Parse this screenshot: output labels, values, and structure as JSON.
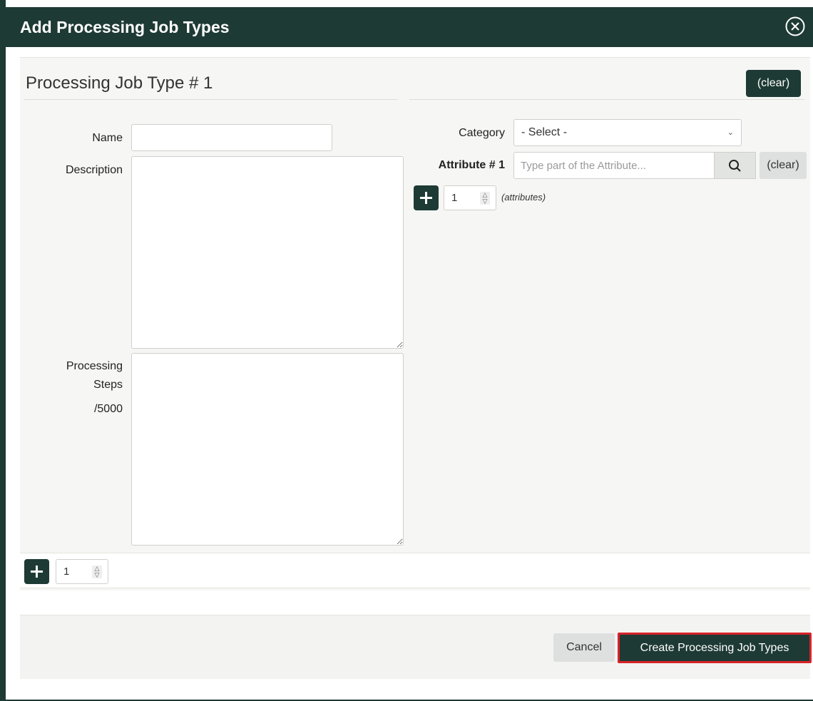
{
  "dialog": {
    "title": "Add Processing Job Types"
  },
  "section": {
    "title": "Processing Job Type # 1",
    "clear_label": "(clear)"
  },
  "form": {
    "name_label": "Name",
    "name_value": "",
    "description_label": "Description",
    "description_value": "",
    "steps_label_1": "Processing",
    "steps_label_2": "Steps",
    "steps_counter": "/5000",
    "steps_value": "",
    "category_label": "Category",
    "category_selected": "- Select -",
    "attribute_label": "Attribute # 1",
    "attribute_placeholder": "Type part of the Attribute...",
    "attribute_clear_label": "(clear)",
    "attribute_count": "1",
    "attribute_hint": "(attributes)"
  },
  "bottom": {
    "job_count": "1"
  },
  "footer": {
    "cancel_label": "Cancel",
    "create_label": "Create Processing Job Types"
  },
  "colors": {
    "primary": "#1e3a34",
    "highlight_border": "#d8232a"
  },
  "icons": {
    "close": "close-circle-icon",
    "search": "search-icon",
    "plus": "plus-icon",
    "spinner": "spinner-arrows-icon",
    "dropdown": "chevron-down-icon"
  }
}
